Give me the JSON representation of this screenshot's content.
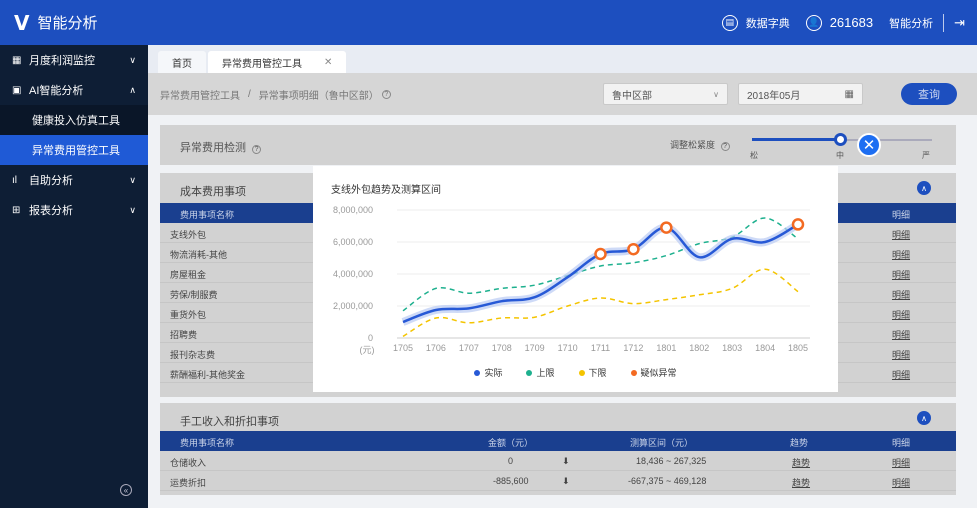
{
  "app": {
    "title": "智能分析"
  },
  "topbar": {
    "dict_label": "数据字典",
    "user_id": "261683",
    "user_role": "智能分析"
  },
  "sidebar": {
    "items": [
      {
        "label": "月度利润监控",
        "chev": "∨"
      },
      {
        "label": "AI智能分析",
        "chev": "∧"
      },
      {
        "label": "自助分析",
        "chev": "∨"
      },
      {
        "label": "报表分析",
        "chev": "∨"
      }
    ],
    "subitems": [
      "健康投入仿真工具",
      "异常费用管控工具"
    ]
  },
  "tabs": [
    {
      "label": "首页"
    },
    {
      "label": "异常费用管控工具"
    }
  ],
  "breadcrumb": {
    "part1": "异常费用管控工具",
    "part2": "异常事项明细（鲁中区部）"
  },
  "filters": {
    "region": "鲁中区部",
    "month": "2018年05月",
    "query": "查询"
  },
  "detection": {
    "title": "异常费用检测",
    "strictness_label": "调整松紧度",
    "slider_labels": [
      "松",
      "中",
      "严"
    ],
    "slider_value": 0.5
  },
  "cost_section": {
    "title": "成本费用事项",
    "header_name": "费用事项名称",
    "header_detail": "明细",
    "rows": [
      "支线外包",
      "物流消耗-其他",
      "房屋租金",
      "劳保/制服费",
      "重货外包",
      "招聘费",
      "报刊杂志费",
      "薪酬福利-其他奖金"
    ],
    "detail_text": "明细"
  },
  "manual_section": {
    "title": "手工收入和折扣事项",
    "headers": [
      "费用事项名称",
      "金额（元）",
      "测算区间（元）",
      "趋势",
      "明细"
    ],
    "rows": [
      {
        "name": "仓储收入",
        "amount": "0",
        "arrow": "⬇",
        "range": "18,436 ~ 267,325",
        "trend": "趋势",
        "detail": "明细"
      },
      {
        "name": "运费折扣",
        "amount": "-885,600",
        "arrow": "⬇",
        "range": "-667,375 ~ 469,128",
        "trend": "趋势",
        "detail": "明细"
      }
    ]
  },
  "chart_data": {
    "type": "line",
    "title": "支线外包趋势及测算区间",
    "ylabel_unit": "(元)",
    "ylim": [
      0,
      8000000
    ],
    "yticks": [
      0,
      2000000,
      4000000,
      6000000,
      8000000
    ],
    "ytick_labels": [
      "0",
      "2,000,000",
      "4,000,000",
      "6,000,000",
      "8,000,000"
    ],
    "categories": [
      "1705",
      "1706",
      "1707",
      "1708",
      "1709",
      "1710",
      "1711",
      "1712",
      "1801",
      "1802",
      "1803",
      "1804",
      "1805"
    ],
    "series": [
      {
        "name": "实际",
        "color": "#2759d6",
        "values": [
          1000000,
          1750000,
          1850000,
          2300000,
          2550000,
          3800000,
          5250000,
          5550000,
          6900000,
          5050000,
          6200000,
          6000000,
          7100000
        ]
      },
      {
        "name": "上限",
        "color": "#1db08e",
        "values": [
          1700000,
          3100000,
          2800000,
          3100000,
          3300000,
          3900000,
          4500000,
          4700000,
          5150000,
          5900000,
          6300000,
          7500000,
          6200000
        ]
      },
      {
        "name": "下限",
        "color": "#f4c400",
        "values": [
          100000,
          1250000,
          950000,
          1250000,
          1300000,
          2000000,
          2500000,
          2150000,
          2400000,
          2700000,
          3100000,
          4300000,
          2900000
        ]
      }
    ],
    "anomaly": {
      "name": "疑似异常",
      "color": "#f36a22",
      "indices": [
        6,
        7,
        8,
        12
      ]
    },
    "legend_placement": "bottom-center"
  }
}
